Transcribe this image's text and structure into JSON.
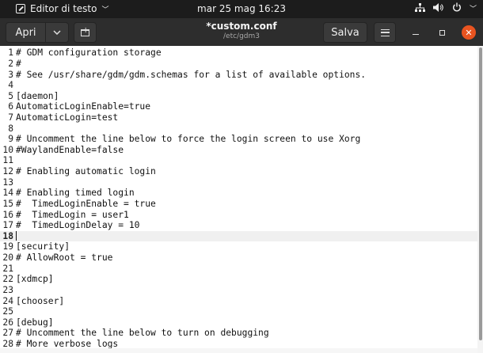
{
  "topbar": {
    "app_name": "Editor di testo",
    "app_menu_arrow": "﹀",
    "clock": "mar 25 mag  16:23",
    "tray": {
      "network_icon": "network-icon",
      "volume_icon": "volume-icon",
      "power_icon": "power-icon",
      "menu_arrow": "﹀",
      "network_glyph": "☰",
      "volume_glyph": "🔈",
      "power_glyph": "⏻"
    }
  },
  "headerbar": {
    "open_label": "Apri",
    "open_arrow": "⌄",
    "file_title": "*custom.conf",
    "file_path": "/etc/gdm3",
    "save_label": "Salva",
    "close_glyph": "✕"
  },
  "editor": {
    "current_line": 18,
    "lines": [
      {
        "n": "1",
        "text": "# GDM configuration storage"
      },
      {
        "n": "2",
        "text": "#"
      },
      {
        "n": "3",
        "text": "# See /usr/share/gdm/gdm.schemas for a list of available options."
      },
      {
        "n": "4",
        "text": ""
      },
      {
        "n": "5",
        "text": "[daemon]"
      },
      {
        "n": "6",
        "text": "AutomaticLoginEnable=true"
      },
      {
        "n": "7",
        "text": "AutomaticLogin=test"
      },
      {
        "n": "8",
        "text": ""
      },
      {
        "n": "9",
        "text": "# Uncomment the line below to force the login screen to use Xorg"
      },
      {
        "n": "10",
        "text": "#WaylandEnable=false"
      },
      {
        "n": "11",
        "text": ""
      },
      {
        "n": "12",
        "text": "# Enabling automatic login"
      },
      {
        "n": "13",
        "text": ""
      },
      {
        "n": "14",
        "text": "# Enabling timed login"
      },
      {
        "n": "15",
        "text": "#  TimedLoginEnable = true"
      },
      {
        "n": "16",
        "text": "#  TimedLogin = user1"
      },
      {
        "n": "17",
        "text": "#  TimedLoginDelay = 10"
      },
      {
        "n": "18",
        "text": ""
      },
      {
        "n": "19",
        "text": "[security]"
      },
      {
        "n": "20",
        "text": "# AllowRoot = true"
      },
      {
        "n": "21",
        "text": ""
      },
      {
        "n": "22",
        "text": "[xdmcp]"
      },
      {
        "n": "23",
        "text": ""
      },
      {
        "n": "24",
        "text": "[chooser]"
      },
      {
        "n": "25",
        "text": ""
      },
      {
        "n": "26",
        "text": "[debug]"
      },
      {
        "n": "27",
        "text": "# Uncomment the line below to turn on debugging"
      },
      {
        "n": "28",
        "text": "# More verbose logs"
      }
    ]
  },
  "colors": {
    "topbar_bg": "#1c1c1c",
    "headerbar_bg": "#2d2d2d",
    "close_button": "#e95420",
    "current_line_bg": "#f0f0f0"
  }
}
